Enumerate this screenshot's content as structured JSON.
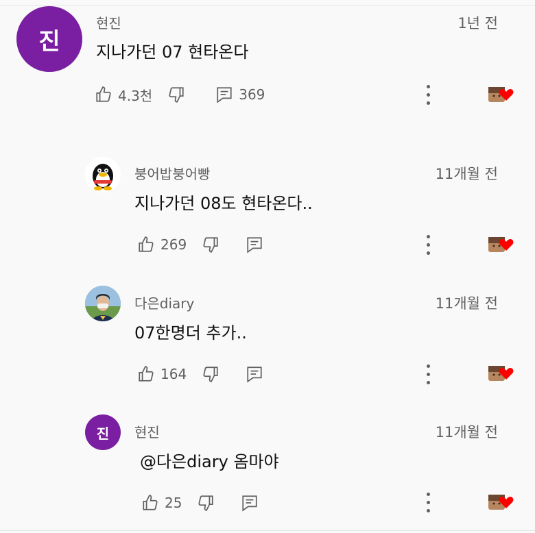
{
  "comments": [
    {
      "author": "현진",
      "avatar_letter": "진",
      "time": "1년 전",
      "text": "지나가던 07 현타온다",
      "likes": "4.3천",
      "replies": "369"
    },
    {
      "author": "붕어밥붕어빵",
      "time": "11개월 전",
      "text": "지나가던 08도 현타온다..",
      "likes": "269"
    },
    {
      "author": "다은diary",
      "time": "11개월 전",
      "text": "07한명더 추가..",
      "likes": "164"
    },
    {
      "author": "현진",
      "avatar_letter": "진",
      "time": "11개월 전",
      "text": "@다은diary  옴마야",
      "likes": "25"
    }
  ],
  "colors": {
    "avatar_purple": "#7b1fa2",
    "heart": "#ff0000",
    "secondary_text": "#606060"
  },
  "icons": [
    "thumbs-up-icon",
    "thumbs-down-icon",
    "reply-icon",
    "more-vertical-icon",
    "creator-heart-icon"
  ]
}
